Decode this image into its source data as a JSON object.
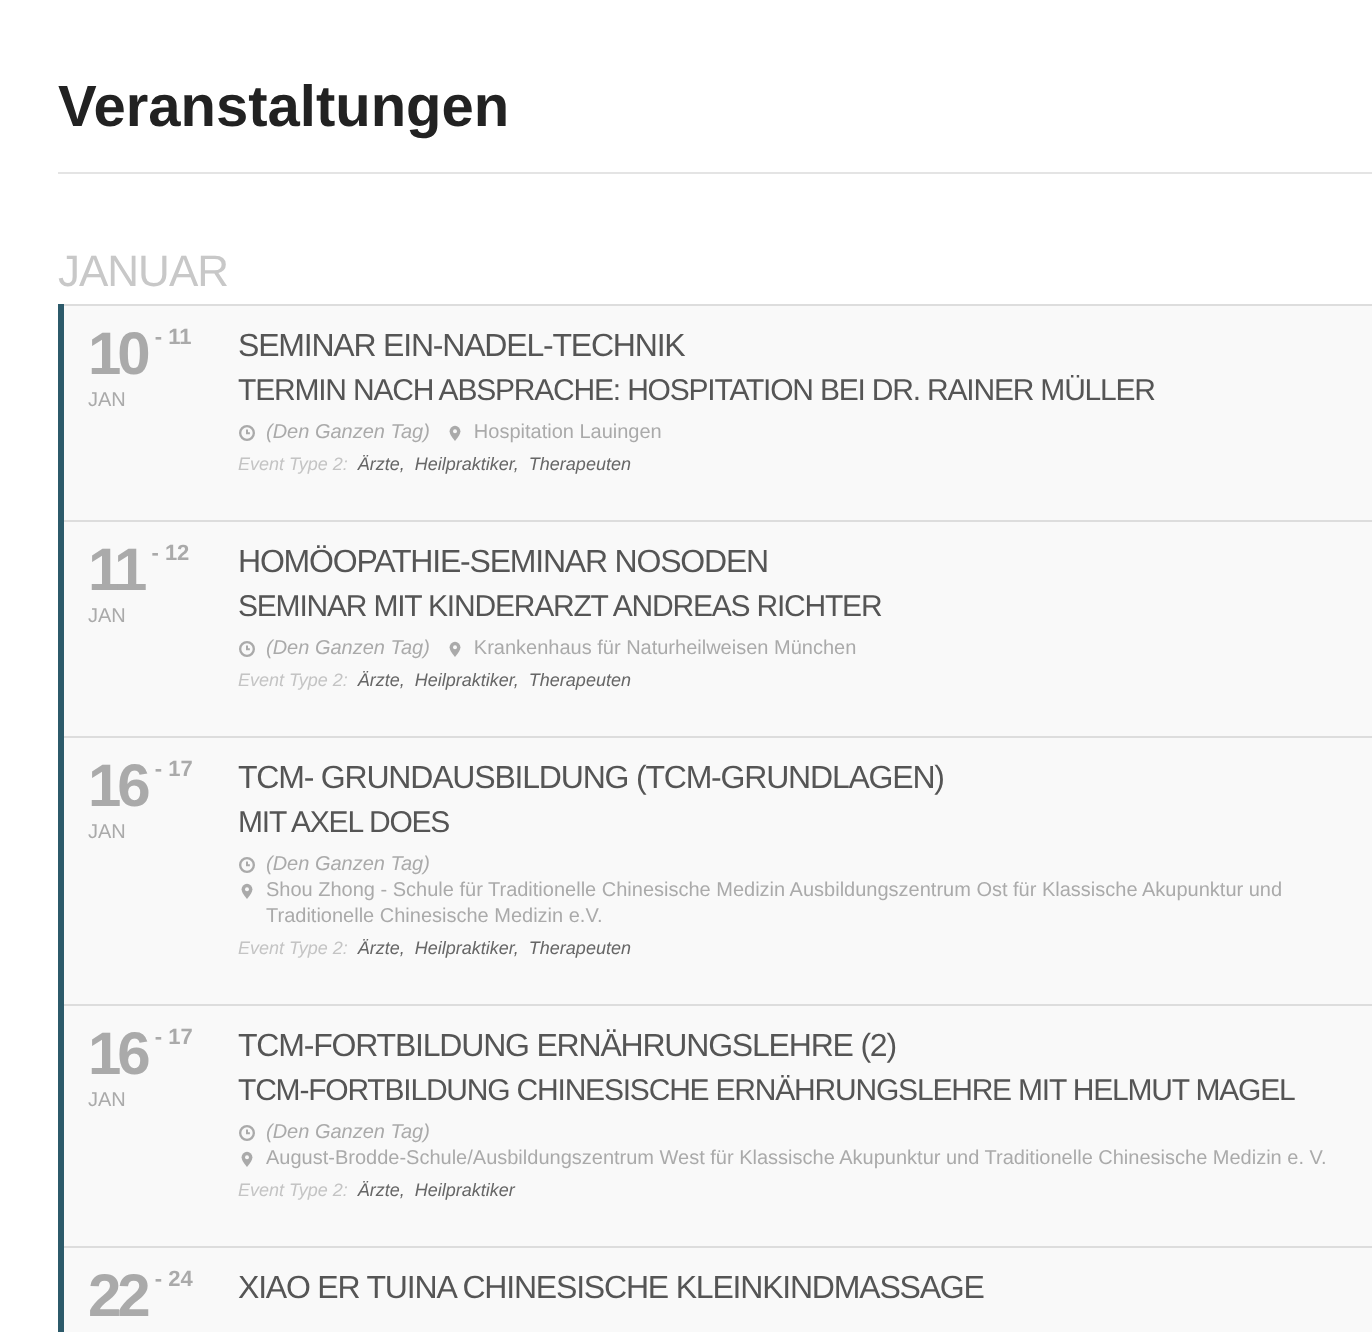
{
  "page_title": "Veranstaltungen",
  "months": [
    {
      "label": "JANUAR",
      "events": [
        {
          "day": "10",
          "end_day": "- 11",
          "month": "JAN",
          "title": "SEMINAR EIN-NADEL-TECHNIK",
          "subtitle": "TERMIN NACH ABSPRACHE: HOSPITATION BEI DR. RAINER MÜLLER",
          "time": "(Den Ganzen Tag)",
          "location": "Hospitation Lauingen",
          "type_label": "Event Type 2:",
          "types": [
            "Ärzte,",
            "Heilpraktiker,",
            "Therapeuten"
          ]
        },
        {
          "day": "11",
          "end_day": "- 12",
          "month": "JAN",
          "title": "HOMÖOPATHIE-SEMINAR NOSODEN",
          "subtitle": "SEMINAR MIT KINDERARZT ANDREAS RICHTER",
          "time": "(Den Ganzen Tag)",
          "location": "Krankenhaus für Naturheilweisen München",
          "type_label": "Event Type 2:",
          "types": [
            "Ärzte,",
            "Heilpraktiker,",
            "Therapeuten"
          ]
        },
        {
          "day": "16",
          "end_day": "- 17",
          "month": "JAN",
          "title": "TCM- GRUNDAUSBILDUNG (TCM-GRUNDLAGEN)",
          "subtitle": "MIT AXEL DOES",
          "time": "(Den Ganzen Tag)",
          "location": "Shou Zhong - Schule für Traditionelle Chinesische Medizin Ausbildungszentrum Ost für Klassische Akupunktur und Traditionelle Chinesische Medizin e.V.",
          "type_label": "Event Type 2:",
          "types": [
            "Ärzte,",
            "Heilpraktiker,",
            "Therapeuten"
          ]
        },
        {
          "day": "16",
          "end_day": "- 17",
          "month": "JAN",
          "title": "TCM-FORTBILDUNG ERNÄHRUNGSLEHRE (2)",
          "subtitle": "TCM-FORTBILDUNG CHINESISCHE ERNÄHRUNGSLEHRE MIT HELMUT MAGEL",
          "time": "(Den Ganzen Tag)",
          "location": "August-Brodde-Schule/Ausbildungszentrum West für Klassische Akupunktur und Traditionelle Chinesische Medizin e. V.",
          "type_label": "Event Type 2:",
          "types": [
            "Ärzte,",
            "Heilpraktiker"
          ]
        },
        {
          "day": "22",
          "end_day": "- 24",
          "title": "XIAO ER TUINA CHINESISCHE KLEINKINDMASSAGE"
        }
      ]
    }
  ]
}
